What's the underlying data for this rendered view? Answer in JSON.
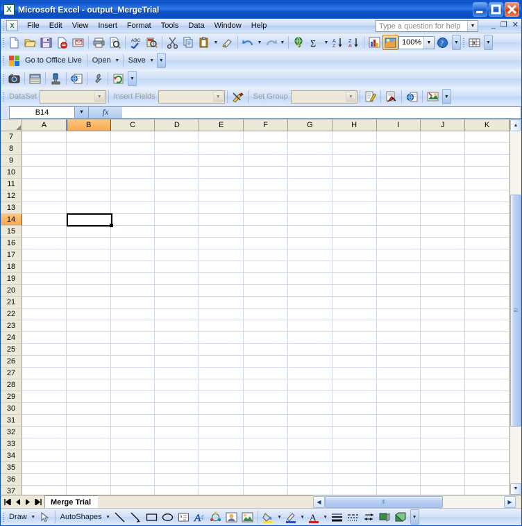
{
  "window": {
    "title": "Microsoft Excel - output_MergeTrial",
    "app_icon": "excel-icon",
    "minimize": "minimize-icon",
    "maximize": "maximize-icon",
    "close": "close-icon"
  },
  "menubar": {
    "items": [
      {
        "label": "File"
      },
      {
        "label": "Edit"
      },
      {
        "label": "View"
      },
      {
        "label": "Insert"
      },
      {
        "label": "Format"
      },
      {
        "label": "Tools"
      },
      {
        "label": "Data"
      },
      {
        "label": "Window"
      },
      {
        "label": "Help"
      }
    ],
    "ask_placeholder": "Type a question for help",
    "doc_minimize": "_",
    "doc_restore": "❐",
    "doc_close": "✕"
  },
  "standard_toolbar": {
    "buttons": [
      {
        "name": "new-icon"
      },
      {
        "name": "open-icon"
      },
      {
        "name": "save-icon"
      },
      {
        "name": "permission-icon"
      },
      {
        "name": "email-icon"
      },
      {
        "name": "print-icon"
      },
      {
        "name": "print-preview-icon"
      },
      {
        "name": "spelling-icon"
      },
      {
        "name": "research-icon"
      },
      {
        "name": "cut-icon"
      },
      {
        "name": "copy-icon"
      },
      {
        "name": "paste-icon"
      },
      {
        "name": "format-painter-icon"
      },
      {
        "name": "undo-icon"
      },
      {
        "name": "redo-icon"
      },
      {
        "name": "hyperlink-icon"
      },
      {
        "name": "autosum-icon"
      },
      {
        "name": "sort-ascending-icon"
      },
      {
        "name": "sort-descending-icon"
      },
      {
        "name": "chart-wizard-icon"
      },
      {
        "name": "drawing-icon"
      }
    ],
    "zoom_value": "100%",
    "help_icon": "help-icon",
    "overflow": "toolbar-options"
  },
  "officelive_toolbar": {
    "goto_label": "Go to Office Live",
    "open_label": "Open",
    "save_label": "Save"
  },
  "addin_toolbar": {
    "buttons": [
      {
        "name": "camera-icon"
      },
      {
        "name": "report-icon"
      },
      {
        "name": "connect-icon"
      },
      {
        "name": "web-query-icon"
      },
      {
        "name": "settings-wrench-icon"
      },
      {
        "name": "refresh-icon"
      }
    ]
  },
  "dataset_toolbar": {
    "dataset_label": "DataSet",
    "dataset_value": "",
    "insert_fields_label": "Insert Fields",
    "insert_fields_value": "",
    "tools_icon": "tools-icon",
    "set_group_label": "Set Group",
    "set_group_value": "",
    "buttons": [
      {
        "name": "edit-script-icon"
      },
      {
        "name": "run-icon"
      },
      {
        "name": "publish-web-icon"
      },
      {
        "name": "design-icon"
      }
    ]
  },
  "formula_bar": {
    "name_box": "B14",
    "fx_label": "fx",
    "formula_value": ""
  },
  "grid": {
    "columns": [
      "A",
      "B",
      "C",
      "D",
      "E",
      "F",
      "G",
      "H",
      "I",
      "J",
      "K"
    ],
    "rows": [
      "7",
      "8",
      "9",
      "10",
      "11",
      "12",
      "13",
      "14",
      "15",
      "16",
      "17",
      "18",
      "19",
      "20",
      "21",
      "22",
      "23",
      "24",
      "25",
      "26",
      "27",
      "28",
      "29",
      "30",
      "31",
      "32",
      "33",
      "34",
      "35",
      "36",
      "37"
    ],
    "selected_cell": "B14",
    "selected_column": "B",
    "selected_row": "14",
    "selection_color": "#f7a94a",
    "cells": []
  },
  "sheet_tabs": {
    "first_icon": "first-sheet-icon",
    "prev_icon": "prev-sheet-icon",
    "next_icon": "next-sheet-icon",
    "last_icon": "last-sheet-icon",
    "tabs": [
      {
        "label": "Merge Trial",
        "active": true
      }
    ]
  },
  "drawing_toolbar": {
    "draw_label": "Draw",
    "select_icon": "select-objects-icon",
    "autoshapes_label": "AutoShapes",
    "buttons": [
      {
        "name": "line-icon"
      },
      {
        "name": "arrow-icon"
      },
      {
        "name": "rectangle-icon"
      },
      {
        "name": "oval-icon"
      },
      {
        "name": "text-box-icon"
      },
      {
        "name": "wordart-icon"
      },
      {
        "name": "diagram-icon"
      },
      {
        "name": "clip-art-icon"
      },
      {
        "name": "picture-icon"
      },
      {
        "name": "fill-color-icon"
      },
      {
        "name": "line-color-icon"
      },
      {
        "name": "font-color-icon"
      },
      {
        "name": "line-style-icon"
      },
      {
        "name": "dash-style-icon"
      },
      {
        "name": "arrow-style-icon"
      },
      {
        "name": "shadow-style-icon"
      },
      {
        "name": "3d-style-icon"
      }
    ]
  },
  "colors": {
    "title_blue": "#0d50c8",
    "toolbar_blue": "#cfe0f8",
    "header_beige": "#ece9d8",
    "selection_orange": "#f7a94a",
    "grid_line": "#d0d7e5"
  }
}
